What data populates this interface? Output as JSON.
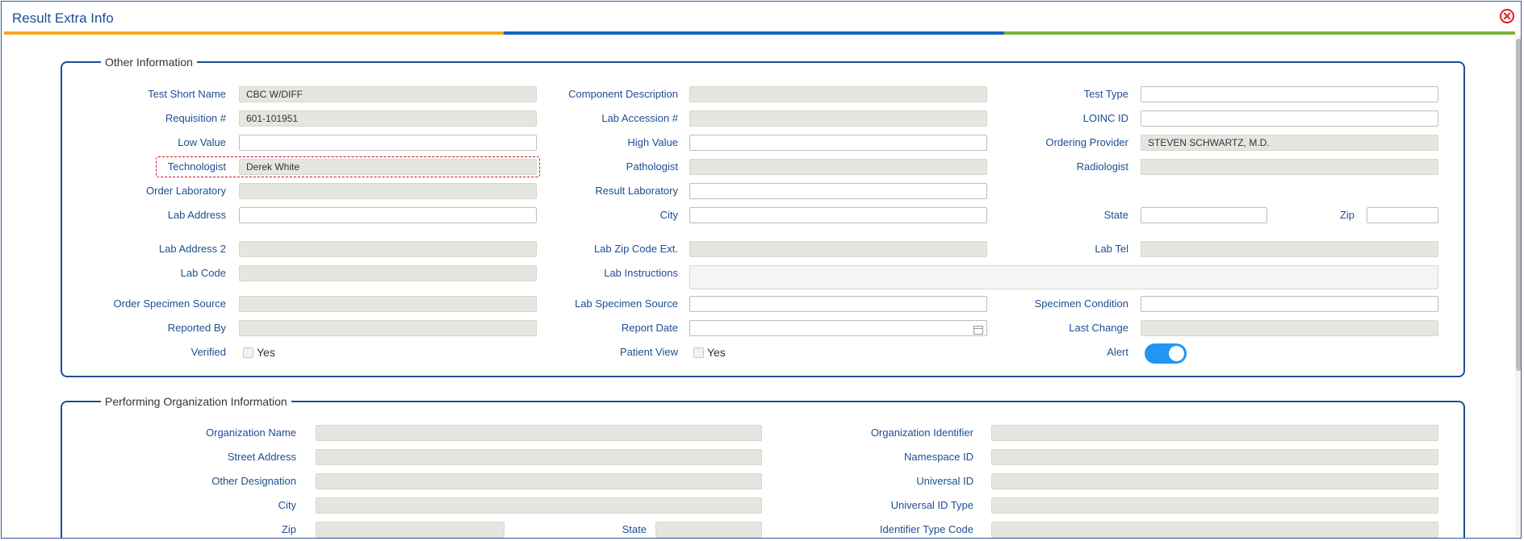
{
  "window": {
    "title": "Result Extra Info",
    "close_glyph": "✕"
  },
  "other_info": {
    "legend": "Other Information",
    "test_short_name": {
      "label": "Test Short Name",
      "value": "CBC W/DIFF"
    },
    "component_description": {
      "label": "Component Description",
      "value": ""
    },
    "test_type": {
      "label": "Test Type",
      "value": ""
    },
    "requisition": {
      "label": "Requisition #",
      "value": "601-101951"
    },
    "lab_accession": {
      "label": "Lab Accession #",
      "value": ""
    },
    "loinc_id": {
      "label": "LOINC ID",
      "value": ""
    },
    "low_value": {
      "label": "Low Value",
      "value": ""
    },
    "high_value": {
      "label": "High Value",
      "value": ""
    },
    "ordering_provider": {
      "label": "Ordering Provider",
      "value": "STEVEN SCHWARTZ, M.D."
    },
    "technologist": {
      "label": "Technologist",
      "value": "Derek White"
    },
    "pathologist": {
      "label": "Pathologist",
      "value": ""
    },
    "radiologist": {
      "label": "Radiologist",
      "value": ""
    },
    "order_laboratory": {
      "label": "Order Laboratory",
      "value": ""
    },
    "result_laboratory": {
      "label": "Result Laboratory",
      "value": ""
    },
    "lab_address": {
      "label": "Lab Address",
      "value": ""
    },
    "city": {
      "label": "City",
      "value": ""
    },
    "state": {
      "label": "State",
      "value": ""
    },
    "zip": {
      "label": "Zip",
      "value": ""
    },
    "lab_address_2": {
      "label": "Lab Address 2",
      "value": ""
    },
    "lab_zip_code_ext": {
      "label": "Lab Zip Code Ext.",
      "value": ""
    },
    "lab_tel": {
      "label": "Lab Tel",
      "value": ""
    },
    "lab_code": {
      "label": "Lab Code",
      "value": ""
    },
    "lab_instructions": {
      "label": "Lab Instructions",
      "value": ""
    },
    "order_specimen_source": {
      "label": "Order Specimen Source",
      "value": ""
    },
    "lab_specimen_source": {
      "label": "Lab Specimen Source",
      "value": ""
    },
    "specimen_condition": {
      "label": "Specimen Condition",
      "value": ""
    },
    "reported_by": {
      "label": "Reported By",
      "value": ""
    },
    "report_date": {
      "label": "Report Date",
      "value": ""
    },
    "last_change": {
      "label": "Last Change",
      "value": ""
    },
    "verified": {
      "label": "Verified",
      "option": "Yes",
      "checked": false
    },
    "patient_view": {
      "label": "Patient View",
      "option": "Yes",
      "checked": false
    },
    "alert": {
      "label": "Alert",
      "on": true
    }
  },
  "performing_org": {
    "legend": "Performing Organization Information",
    "organization_name": {
      "label": "Organization Name",
      "value": ""
    },
    "organization_identifier": {
      "label": "Organization Identifier",
      "value": ""
    },
    "street_address": {
      "label": "Street Address",
      "value": ""
    },
    "namespace_id": {
      "label": "Namespace ID",
      "value": ""
    },
    "other_designation": {
      "label": "Other Designation",
      "value": ""
    },
    "universal_id": {
      "label": "Universal ID",
      "value": ""
    },
    "city": {
      "label": "City",
      "value": ""
    },
    "universal_id_type": {
      "label": "Universal ID Type",
      "value": ""
    },
    "zip": {
      "label": "Zip",
      "value": ""
    },
    "state": {
      "label": "State",
      "value": ""
    },
    "identifier_type_code": {
      "label": "Identifier Type Code",
      "value": ""
    }
  },
  "colors": {
    "accent": "#1d4f91",
    "toggle_on": "#2196f3",
    "close": "#e01b24",
    "stripe_orange": "#f5a623",
    "stripe_blue": "#1565c0",
    "stripe_green": "#7cb342"
  }
}
